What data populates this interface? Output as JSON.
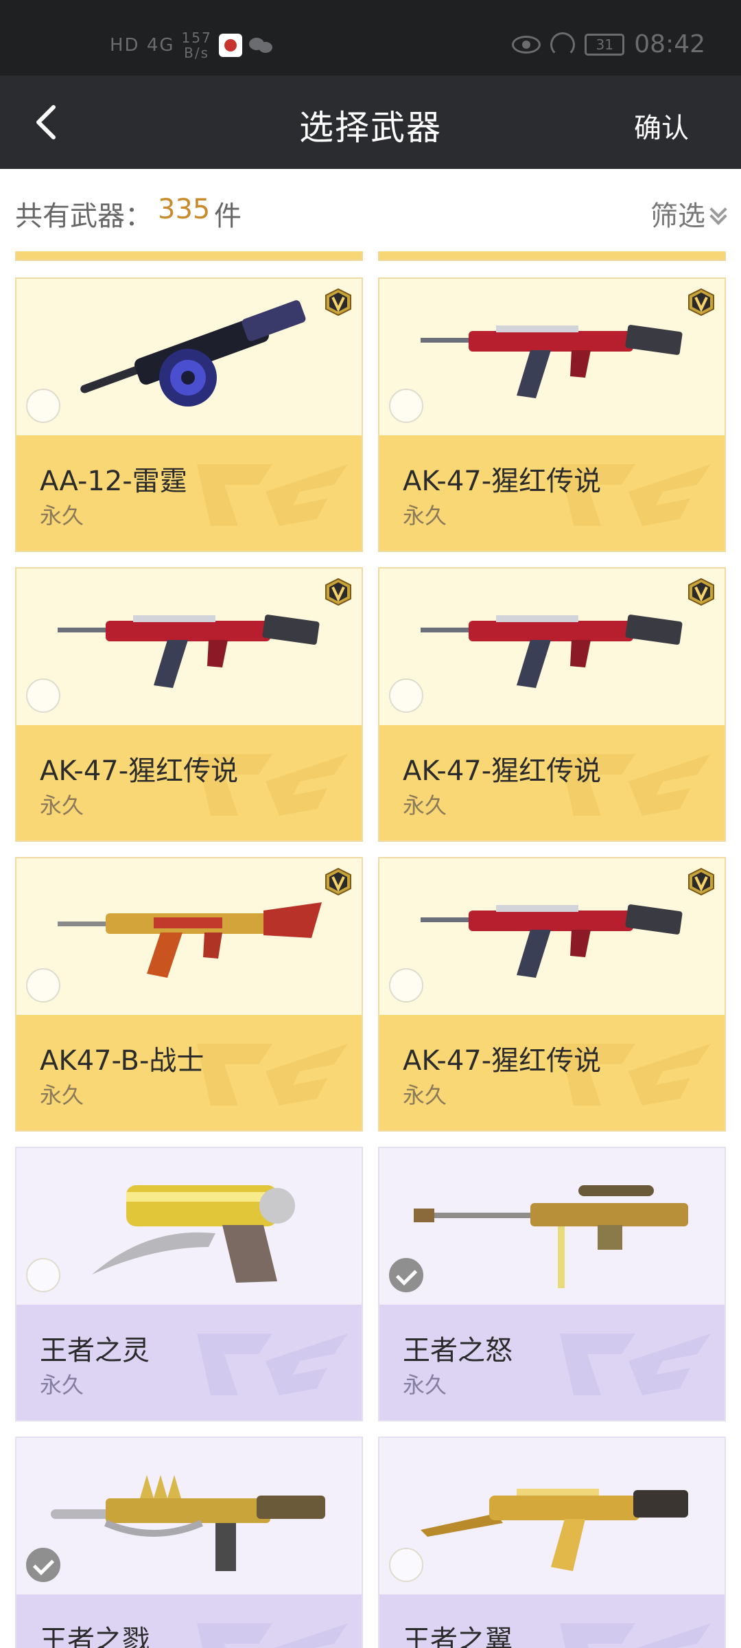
{
  "status_bar": {
    "network": "HD 4G",
    "speed_value": "157",
    "speed_unit": "B/s",
    "battery": "31",
    "time": "08:42"
  },
  "header": {
    "title": "选择武器",
    "confirm_label": "确认"
  },
  "summary": {
    "label": "共有武器：",
    "count": "335",
    "unit": "件",
    "filter_label": "筛选"
  },
  "icons": {
    "back": "chevron-left-icon",
    "filter": "double-chevron-down-icon",
    "badge": "v-badge-icon",
    "watermark": "cf-logo-icon",
    "check": "check-icon"
  },
  "colors": {
    "gold_card": "#f8d774",
    "gold_image_bg": "#fef8dc",
    "purple_card": "#ddd4f3",
    "purple_image_bg": "#f3f0fb",
    "count_accent": "#c98a2c",
    "header_bg": "#2b2c30"
  },
  "weapons": [
    {
      "name": "AA-12-雷霆",
      "duration": "永久",
      "tier": "gold",
      "selected": false,
      "badge": true,
      "art": "drum-shotgun"
    },
    {
      "name": "AK-47-猩红传说",
      "duration": "永久",
      "tier": "gold",
      "selected": false,
      "badge": true,
      "art": "red-rifle"
    },
    {
      "name": "AK-47-猩红传说",
      "duration": "永久",
      "tier": "gold",
      "selected": false,
      "badge": true,
      "art": "red-rifle"
    },
    {
      "name": "AK-47-猩红传说",
      "duration": "永久",
      "tier": "gold",
      "selected": false,
      "badge": true,
      "art": "red-rifle"
    },
    {
      "name": "AK47-B-战士",
      "duration": "永久",
      "tier": "gold",
      "selected": false,
      "badge": true,
      "art": "gold-red-rifle"
    },
    {
      "name": "AK-47-猩红传说",
      "duration": "永久",
      "tier": "gold",
      "selected": false,
      "badge": true,
      "art": "red-rifle"
    },
    {
      "name": "王者之灵",
      "duration": "永久",
      "tier": "purple",
      "selected": false,
      "badge": false,
      "art": "gold-pistol"
    },
    {
      "name": "王者之怒",
      "duration": "永久",
      "tier": "purple",
      "selected": true,
      "badge": false,
      "art": "gold-sniper"
    },
    {
      "name": "王者之戮",
      "duration": "",
      "tier": "purple",
      "selected": true,
      "badge": false,
      "art": "gold-m4"
    },
    {
      "name": "王者之翼",
      "duration": "",
      "tier": "purple",
      "selected": false,
      "badge": false,
      "art": "gold-ak"
    }
  ]
}
